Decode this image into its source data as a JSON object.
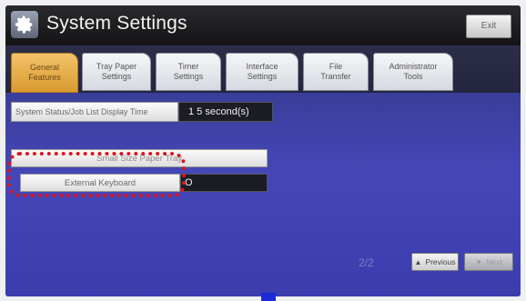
{
  "header": {
    "title": "System Settings",
    "exit_label": "Exit",
    "icon": "settings-gear-icon"
  },
  "tabs": [
    {
      "label": "General\nFeatures",
      "active": true
    },
    {
      "label": "Tray Paper\nSettings",
      "active": false
    },
    {
      "label": "Timer\nSettings",
      "active": false
    },
    {
      "label": "Interface\nSettings",
      "active": false
    },
    {
      "label": "File\nTransfer",
      "active": false
    },
    {
      "label": "Administrator\nTools",
      "active": false
    }
  ],
  "settings": {
    "status_display": {
      "label": "System Status/Job List Display Time",
      "value": "1 5 second(s)"
    },
    "small_paper_tray": {
      "label": "Small Size Paper Tray"
    },
    "external_keyboard": {
      "label": "External Keyboard",
      "value": "O"
    }
  },
  "pagination": {
    "page": "2/2",
    "previous_label": "Previous",
    "next_label": "Next"
  },
  "colors": {
    "active_tab": "#e0a93f",
    "content_bg": "#4244b2",
    "highlight": "#e0141e"
  }
}
